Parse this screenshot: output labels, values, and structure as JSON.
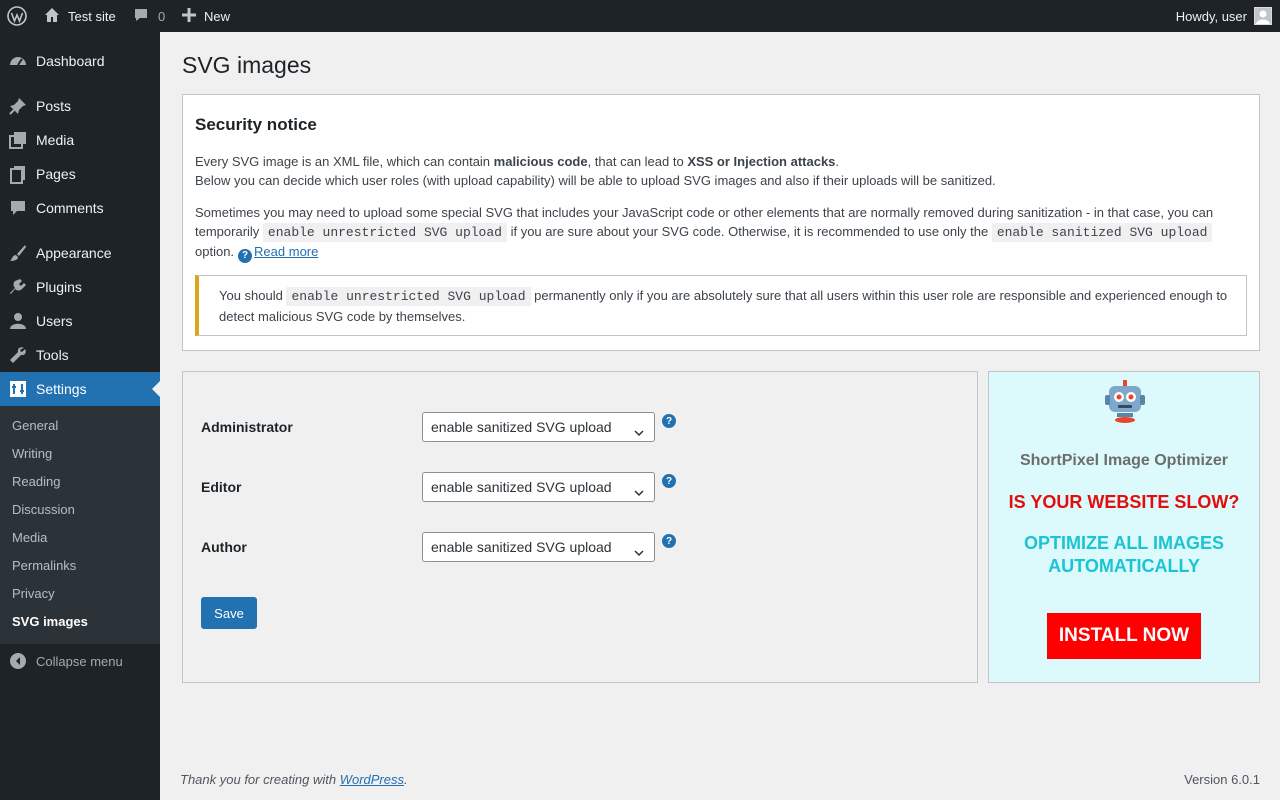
{
  "adminbar": {
    "site_name": "Test site",
    "comments_count": "0",
    "new_label": "New",
    "howdy": "Howdy, user"
  },
  "sidebar": {
    "items": [
      {
        "label": "Dashboard",
        "icon": "dashboard-icon"
      },
      {
        "label": "Posts",
        "icon": "pin-icon"
      },
      {
        "label": "Media",
        "icon": "media-icon"
      },
      {
        "label": "Pages",
        "icon": "pages-icon"
      },
      {
        "label": "Comments",
        "icon": "comment-icon"
      },
      {
        "label": "Appearance",
        "icon": "brush-icon"
      },
      {
        "label": "Plugins",
        "icon": "plug-icon"
      },
      {
        "label": "Users",
        "icon": "user-icon"
      },
      {
        "label": "Tools",
        "icon": "wrench-icon"
      },
      {
        "label": "Settings",
        "icon": "settings-icon"
      }
    ],
    "submenu": [
      "General",
      "Writing",
      "Reading",
      "Discussion",
      "Media",
      "Permalinks",
      "Privacy",
      "SVG images"
    ],
    "collapse_label": "Collapse menu"
  },
  "page": {
    "title": "SVG images"
  },
  "notice": {
    "heading": "Security notice",
    "p1_a": "Every SVG image is an XML file, which can contain ",
    "p1_b": "malicious code",
    "p1_c": ", that can lead to ",
    "p1_d": "XSS or Injection attacks",
    "p1_e": ".",
    "p1_line2": "Below you can decide which user roles (with upload capability) will be able to upload SVG images and also if their uploads will be sanitized.",
    "p2_a": "Sometimes you may need to upload some special SVG that includes your JavaScript code or other elements that are normally removed during sanitization - in that case, you can temporarily ",
    "p2_code1": "enable unrestricted SVG upload",
    "p2_b": " if you are sure about your SVG code. Otherwise, it is recommended to use only the ",
    "p2_code2": "enable sanitized SVG upload",
    "p2_c": " option.",
    "read_more": "Read more",
    "warn_a": "You should ",
    "warn_code": "enable unrestricted SVG upload",
    "warn_b": " permanently only if you are absolutely sure that all users within this user role are responsible and experienced enough to detect malicious SVG code by themselves."
  },
  "settings": {
    "roles": [
      {
        "label": "Administrator",
        "value": "enable sanitized SVG upload"
      },
      {
        "label": "Editor",
        "value": "enable sanitized SVG upload"
      },
      {
        "label": "Author",
        "value": "enable sanitized SVG upload"
      }
    ],
    "save_label": "Save"
  },
  "ad": {
    "title": "ShortPixel Image Optimizer",
    "slow": "IS YOUR WEBSITE SLOW?",
    "optimize": "OPTIMIZE ALL IMAGES AUTOMATICALLY",
    "install": "INSTALL NOW"
  },
  "footer": {
    "thanks_a": "Thank you for creating with ",
    "thanks_link": "WordPress",
    "thanks_b": ".",
    "version": "Version 6.0.1"
  }
}
